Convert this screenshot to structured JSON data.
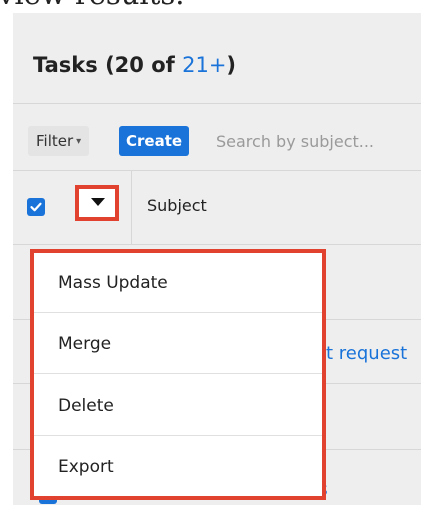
{
  "top_caption": "view results.",
  "header": {
    "title": "Tasks",
    "count_prefix": "(20 of ",
    "count_link": "21+",
    "count_suffix": ")"
  },
  "toolbar": {
    "filter_label": "Filter",
    "filter_caret": "▾",
    "create_label": "Create",
    "search_placeholder": "Search by subject..."
  },
  "table": {
    "subject_header": "Subject",
    "select_all_checked": true
  },
  "rows": {
    "visible_link_fragment": "t request",
    "bottom_link_fragment": "ss"
  },
  "actions_menu": {
    "items": [
      {
        "label": "Mass Update"
      },
      {
        "label": "Merge"
      },
      {
        "label": "Delete"
      },
      {
        "label": "Export"
      }
    ]
  },
  "colors": {
    "accent": "#1a73d9",
    "highlight": "#e0422f",
    "panel": "#eeeeee"
  },
  "icons": {
    "actions_toggle": "caret-down-icon",
    "select_all": "check-icon"
  }
}
